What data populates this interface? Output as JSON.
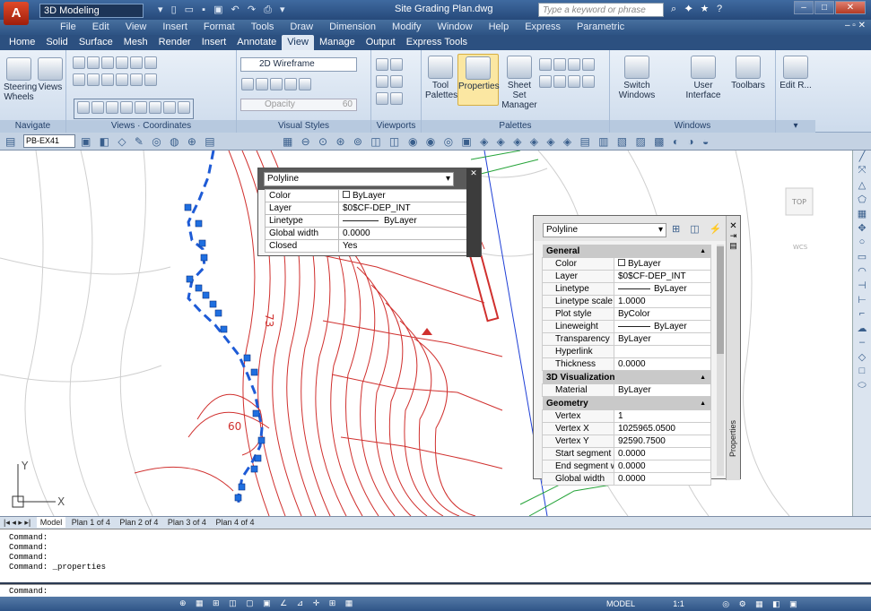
{
  "app": {
    "logo": "A",
    "workspace": "3D Modeling",
    "window_title": "Site Grading Plan.dwg",
    "search_placeholder": "Type a keyword or phrase"
  },
  "menu": [
    "File",
    "Edit",
    "View",
    "Insert",
    "Format",
    "Tools",
    "Draw",
    "Dimension",
    "Modify",
    "Window",
    "Help",
    "Express",
    "Parametric"
  ],
  "tabs": [
    "Home",
    "Solid",
    "Surface",
    "Mesh",
    "Render",
    "Insert",
    "Annotate",
    "View",
    "Manage",
    "Output",
    "Express Tools"
  ],
  "active_tab": "View",
  "ribbon": {
    "navigate": {
      "label": "Navigate",
      "steering": "Steering Wheels",
      "views": "Views"
    },
    "coordinates_label": "Coordinates",
    "views_label": "Views",
    "visual_style": "2D Wireframe",
    "opacity_label": "Opacity",
    "opacity_value": "60",
    "visual_styles_label": "Visual Styles",
    "viewports_label": "Viewports",
    "palettes": {
      "label": "Palettes",
      "tool": "Tool Palettes",
      "properties": "Properties",
      "sheetset": "Sheet Set Manager"
    },
    "windows": {
      "label": "Windows",
      "switch": "Switch Windows",
      "user": "User Interface",
      "toolbars": "Toolbars"
    },
    "edit": "Edit R..."
  },
  "layer_current": "PB-EX41",
  "drawing_labels": [
    "60",
    "73",
    "X",
    "Y"
  ],
  "viewcube": {
    "top": "TOP",
    "wcs": "WCS"
  },
  "quick_props": {
    "type": "Polyline",
    "rows": [
      [
        "Color",
        "ByLayer"
      ],
      [
        "Layer",
        "$0$CF-DEP_INT"
      ],
      [
        "Linetype",
        "ByLayer"
      ],
      [
        "Global width",
        "0.0000"
      ],
      [
        "Closed",
        "Yes"
      ]
    ]
  },
  "properties": {
    "type": "Polyline",
    "side_title": "Properties",
    "sections": [
      {
        "title": "General",
        "rows": [
          [
            "Color",
            "ByLayer"
          ],
          [
            "Layer",
            "$0$CF-DEP_INT"
          ],
          [
            "Linetype",
            "ByLayer"
          ],
          [
            "Linetype scale",
            "1.0000"
          ],
          [
            "Plot style",
            "ByColor"
          ],
          [
            "Lineweight",
            "ByLayer"
          ],
          [
            "Transparency",
            "ByLayer"
          ],
          [
            "Hyperlink",
            ""
          ],
          [
            "Thickness",
            "0.0000"
          ]
        ]
      },
      {
        "title": "3D Visualization",
        "rows": [
          [
            "Material",
            "ByLayer"
          ]
        ]
      },
      {
        "title": "Geometry",
        "rows": [
          [
            "Vertex",
            "1"
          ],
          [
            "Vertex X",
            "1025965.0500"
          ],
          [
            "Vertex Y",
            "92590.7500"
          ],
          [
            "Start segment wi...",
            "0.0000"
          ],
          [
            "End segment wi...",
            "0.0000"
          ],
          [
            "Global width",
            "0.0000"
          ]
        ]
      }
    ]
  },
  "layout_tabs": [
    "Model",
    "Plan 1 of 4",
    "Plan 2 of 4",
    "Plan 3 of 4",
    "Plan 4 of 4"
  ],
  "command_history": [
    "Command:",
    "Command:",
    "Command:",
    "Command:  _properties"
  ],
  "command_prompt": "Command:",
  "status": {
    "space": "MODEL",
    "scale": "1:1"
  },
  "colors": {
    "contour": "#d0302e",
    "polyline": "#1e5bd6",
    "grip": "#1f6fe0",
    "brand": "#c02a0f"
  }
}
